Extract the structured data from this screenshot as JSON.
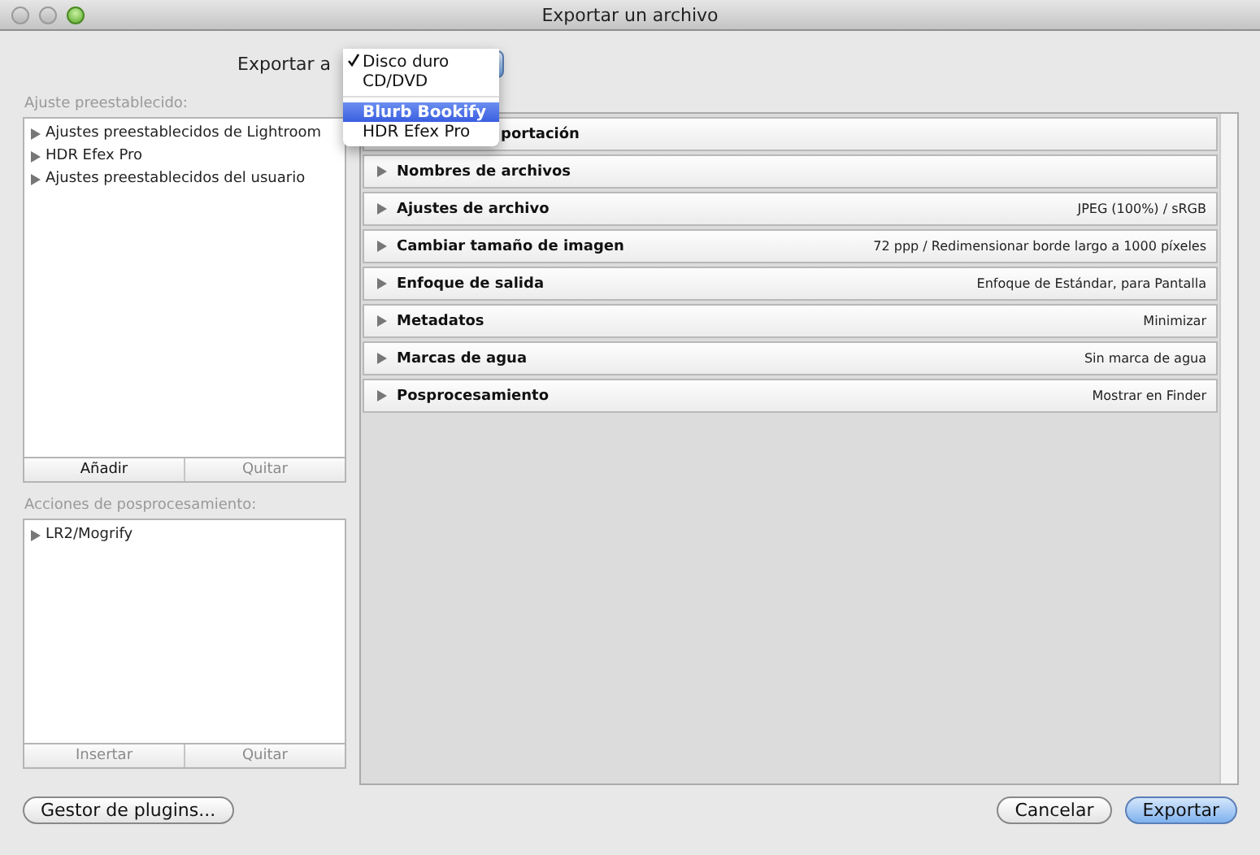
{
  "window": {
    "title": "Exportar un archivo"
  },
  "export_to": {
    "label": "Exportar a",
    "menu_groups": [
      [
        {
          "label": "Disco duro",
          "checked": true,
          "selected": false
        },
        {
          "label": "CD/DVD",
          "checked": false,
          "selected": false
        }
      ],
      [
        {
          "label": "Blurb Bookify",
          "checked": false,
          "selected": true
        },
        {
          "label": "HDR Efex Pro",
          "checked": false,
          "selected": false
        }
      ]
    ]
  },
  "presets": {
    "label": "Ajuste preestablecido:",
    "items": [
      {
        "label": "Ajustes preestablecidos de Lightroom",
        "expanded": false
      },
      {
        "label": "HDR Efex Pro",
        "expanded": false
      },
      {
        "label": "Ajustes preestablecidos del usuario",
        "expanded": false
      }
    ],
    "buttons": [
      {
        "label": "Añadir",
        "disabled": false
      },
      {
        "label": "Quitar",
        "disabled": true
      }
    ]
  },
  "post_actions": {
    "label": "Acciones de posprocesamiento:",
    "items": [
      {
        "label": "LR2/Mogrify",
        "expanded": false
      }
    ],
    "buttons": [
      {
        "label": "Insertar",
        "disabled": true
      },
      {
        "label": "Quitar",
        "disabled": true
      }
    ]
  },
  "sections": [
    {
      "title": "portación"
    },
    {
      "title": "Nombres de archivos",
      "expanded": false
    },
    {
      "title": "Ajustes de archivo",
      "value": "JPEG (100%) / sRGB",
      "expanded": false
    },
    {
      "title": "Cambiar tamaño de imagen",
      "value": "72 ppp / Redimensionar borde largo a 1000 píxeles",
      "expanded": false
    },
    {
      "title": "Enfoque de salida",
      "value": "Enfoque de Estándar, para Pantalla",
      "expanded": false
    },
    {
      "title": "Metadatos",
      "value": "Minimizar",
      "expanded": false
    },
    {
      "title": "Marcas de agua",
      "value": "Sin marca de agua",
      "expanded": false
    },
    {
      "title": "Posprocesamiento",
      "value": "Mostrar en Finder",
      "expanded": false
    }
  ],
  "footer": {
    "left": [
      {
        "label": "Gestor de plugins...",
        "default": false
      }
    ],
    "right": [
      {
        "label": "Cancelar",
        "default": false
      },
      {
        "label": "Exportar",
        "default": true
      }
    ]
  }
}
